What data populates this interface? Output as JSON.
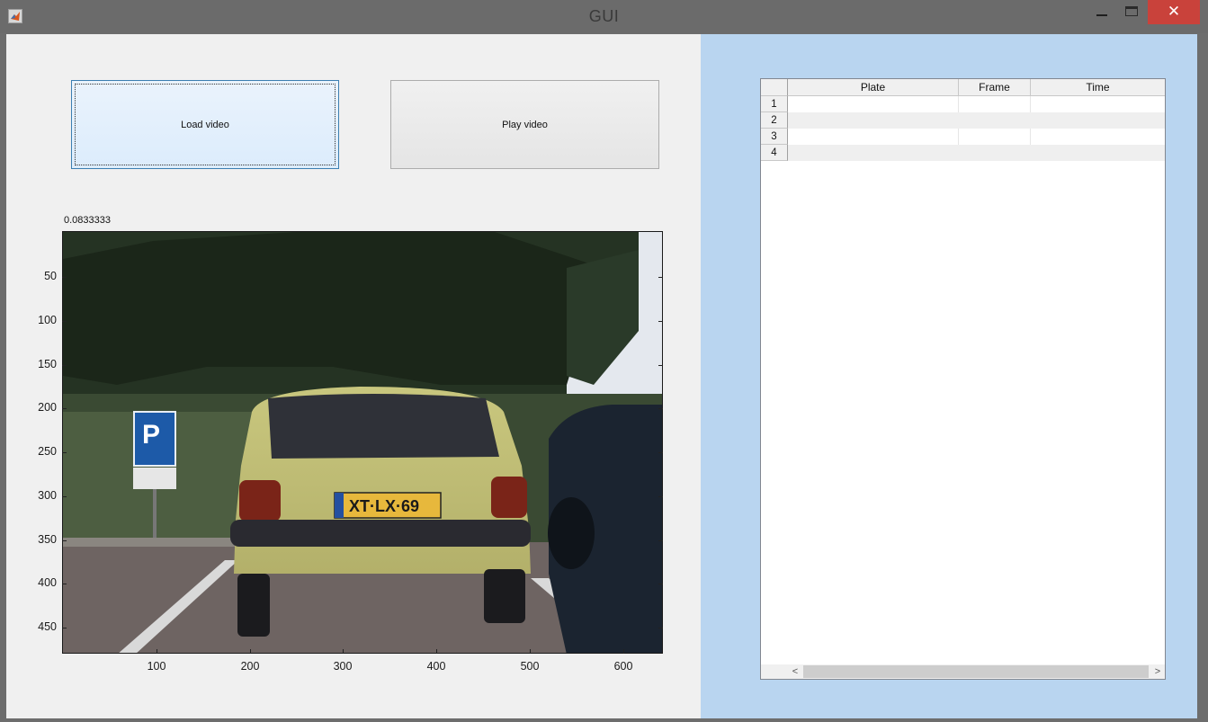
{
  "window": {
    "title": "GUI",
    "close_glyph": "✕"
  },
  "buttons": {
    "load_label": "Load video",
    "play_label": "Play video"
  },
  "axes": {
    "title": "0.0833333",
    "image": "video-frame",
    "yticks": [
      "50",
      "100",
      "150",
      "200",
      "250",
      "300",
      "350",
      "400",
      "450"
    ],
    "xticks": [
      "100",
      "200",
      "300",
      "400",
      "500",
      "600"
    ],
    "plate_text": "XT·LX·69",
    "sign_text": "P"
  },
  "table": {
    "columns": [
      "Plate",
      "Frame",
      "Time"
    ],
    "rows": [
      {
        "num": "1",
        "plate": "",
        "frame": "",
        "time": ""
      },
      {
        "num": "2",
        "plate": "",
        "frame": "",
        "time": ""
      },
      {
        "num": "3",
        "plate": "",
        "frame": "",
        "time": ""
      },
      {
        "num": "4",
        "plate": "",
        "frame": "",
        "time": ""
      }
    ],
    "scroll_left": "<",
    "scroll_right": ">"
  },
  "colors": {
    "titlebar": "#6b6b6b",
    "close": "#c9423b",
    "right_panel": "#b9d5f0",
    "left_panel": "#f0f0f0"
  }
}
